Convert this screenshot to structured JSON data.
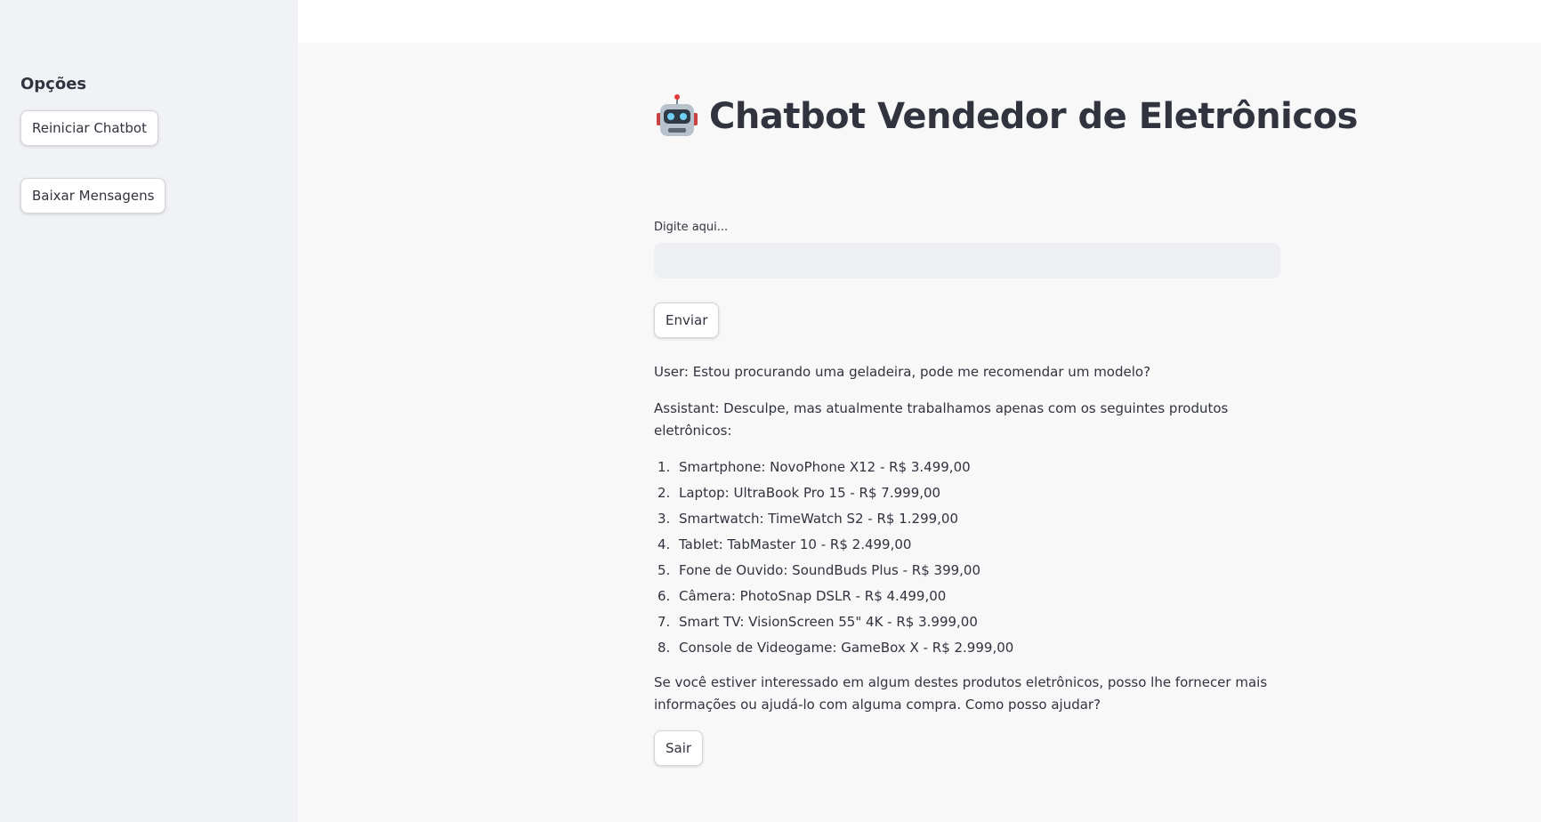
{
  "sidebar": {
    "heading": "Opções",
    "restart_label": "Reiniciar Chatbot",
    "download_label": "Baixar Mensagens"
  },
  "main": {
    "title": "Chatbot Vendedor de Eletrônicos",
    "title_icon": "robot-icon",
    "input_label": "Digite aqui...",
    "input_value": "",
    "send_label": "Enviar",
    "exit_label": "Sair"
  },
  "conversation": {
    "user_message": "User: Estou procurando uma geladeira, pode me recomendar um modelo?",
    "assistant_intro": "Assistant: Desculpe, mas atualmente trabalhamos apenas com os seguintes produtos eletrônicos:",
    "products": [
      {
        "num": "1.",
        "text": "Smartphone: NovoPhone X12 - R$ 3.499,00"
      },
      {
        "num": "2.",
        "text": "Laptop: UltraBook Pro 15 - R$ 7.999,00"
      },
      {
        "num": "3.",
        "text": "Smartwatch: TimeWatch S2 - R$ 1.299,00"
      },
      {
        "num": "4.",
        "text": "Tablet: TabMaster 10 - R$ 2.499,00"
      },
      {
        "num": "5.",
        "text": "Fone de Ouvido: SoundBuds Plus - R$ 399,00"
      },
      {
        "num": "6.",
        "text": "Câmera: PhotoSnap DSLR - R$ 4.499,00"
      },
      {
        "num": "7.",
        "text": "Smart TV: VisionScreen 55\" 4K - R$ 3.999,00"
      },
      {
        "num": "8.",
        "text": "Console de Videogame: GameBox X - R$ 2.999,00"
      }
    ],
    "assistant_closing": "Se você estiver interessado em algum destes produtos eletrônicos, posso lhe fornecer mais informações ou ajudá-lo com alguma compra. Como posso ajudar?"
  }
}
